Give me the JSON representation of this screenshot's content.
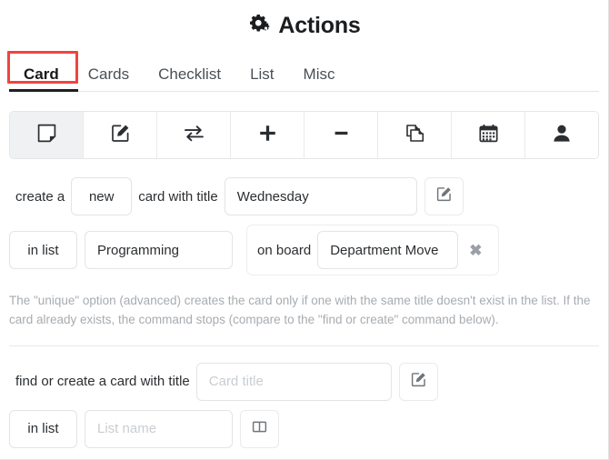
{
  "header": {
    "icon": "gears-icon",
    "title": "Actions"
  },
  "tabs": {
    "items": [
      {
        "label": "Card",
        "active": true
      },
      {
        "label": "Cards",
        "active": false
      },
      {
        "label": "Checklist",
        "active": false
      },
      {
        "label": "List",
        "active": false
      },
      {
        "label": "Misc",
        "active": false
      }
    ],
    "annotation_color": "#f0443e"
  },
  "toolbar": {
    "items": [
      {
        "icon": "sticky-note-icon",
        "active": true
      },
      {
        "icon": "pencil-square-icon",
        "active": false
      },
      {
        "icon": "exchange-arrows-icon",
        "active": false
      },
      {
        "icon": "plus-icon",
        "active": false
      },
      {
        "icon": "minus-icon",
        "active": false
      },
      {
        "icon": "copy-pages-icon",
        "active": false
      },
      {
        "icon": "calendar-icon",
        "active": false
      },
      {
        "icon": "user-icon",
        "active": false
      }
    ]
  },
  "create_command": {
    "prefix": "create a",
    "mode_value": "new",
    "middle": "card with title",
    "title_value": "Wednesday",
    "title_edit_icon": "pencil-square-icon",
    "in_list_label": "in list",
    "list_value": "Programming",
    "on_board_label": "on board",
    "board_value": "Department Move",
    "remove_icon": "close-x-icon"
  },
  "help_text": "The \"unique\" option (advanced) creates the card only if one with the same title doesn't exist in the list. If the card already exists, the command stops (compare to the \"find or create\" command below).",
  "find_command": {
    "prefix": "find or create a card with title",
    "title_value": "",
    "title_placeholder": "Card title",
    "title_edit_icon": "pencil-square-icon",
    "in_list_label": "in list",
    "list_value": "",
    "list_placeholder": "List name",
    "list_board_icon": "columns-icon"
  }
}
